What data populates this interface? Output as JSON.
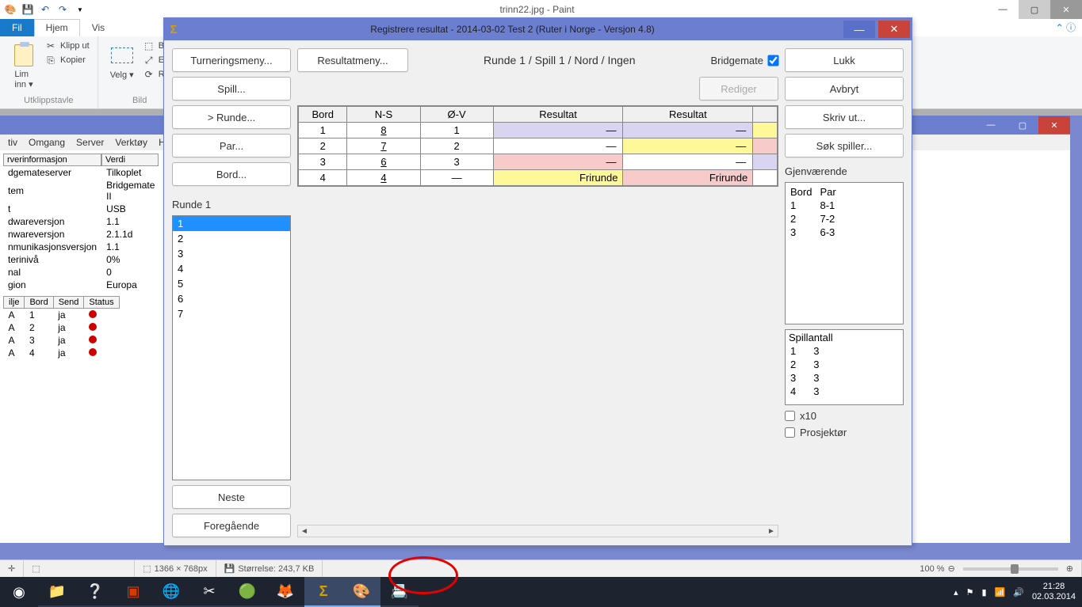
{
  "paint": {
    "title": "trinn22.jpg - Paint",
    "tabs": {
      "fil": "Fil",
      "hjem": "Hjem",
      "vis": "Vis"
    },
    "clipboard": {
      "paste": "Lim\ninn",
      "cut": "Klipp ut",
      "copy": "Kopier",
      "group": "Utklippstavle"
    },
    "image": {
      "select": "Velg",
      "crop": "Bes",
      "resize": "En",
      "rotate": "Rot",
      "group": "Bild"
    },
    "status": {
      "dims": "1366 × 768px",
      "size": "Størrelse: 243,7 KB",
      "zoom": "100 %"
    }
  },
  "bg": {
    "menu": [
      "tiv",
      "Omgang",
      "Server",
      "Verktøy",
      "Hj"
    ],
    "infoHead": [
      "rverinformasjon",
      "Verdi"
    ],
    "info": [
      [
        "dgemateserver",
        "Tilkoplet"
      ],
      [
        "tem",
        "Bridgemate II"
      ],
      [
        "t",
        "USB"
      ],
      [
        "dwareversjon",
        "1.1"
      ],
      [
        "nwareversjon",
        "2.1.1d"
      ],
      [
        "nmunikasjonsversjon",
        "1.1"
      ],
      [
        "terinivå",
        "0%"
      ],
      [
        "nal",
        "0"
      ],
      [
        "gion",
        "Europa"
      ]
    ],
    "tblHead": [
      "ilje",
      "Bord",
      "Send",
      "Status"
    ],
    "rows": [
      [
        "A",
        "1",
        "ja"
      ],
      [
        "A",
        "2",
        "ja"
      ],
      [
        "A",
        "3",
        "ja"
      ],
      [
        "A",
        "4",
        "ja"
      ]
    ]
  },
  "dlg": {
    "title": "Registrere resultat - 2014-03-02  Test 2  (Ruter i Norge - Versjon 4.8)",
    "left": {
      "turn": "Turneringsmeny...",
      "spill": "Spill...",
      "runde": ">   Runde...",
      "par": "Par...",
      "bord": "Bord...",
      "rundeLabel": "Runde 1",
      "rounds": [
        "1",
        "2",
        "3",
        "4",
        "5",
        "6",
        "7"
      ],
      "neste": "Neste",
      "fore": "Foregående"
    },
    "mid": {
      "resmenu": "Resultatmeny...",
      "info": "Runde 1 / Spill 1 / Nord / Ingen",
      "bm": "Bridgemate",
      "rediger": "Rediger",
      "head": [
        "Bord",
        "N-S",
        "Ø-V",
        "Resultat",
        "Resultat"
      ],
      "rows": [
        {
          "bord": "1",
          "ns": "8",
          "ov": "1",
          "r1": "—",
          "r1c": "res-lav",
          "r2": "—",
          "r2c": "res-lav",
          "r3c": "res-yel"
        },
        {
          "bord": "2",
          "ns": "7",
          "ov": "2",
          "r1": "—",
          "r1c": "res-wht",
          "r2": "—",
          "r2c": "res-yel",
          "r3c": "res-pnk"
        },
        {
          "bord": "3",
          "ns": "6",
          "ov": "3",
          "r1": "—",
          "r1c": "res-pnk",
          "r2": "—",
          "r2c": "res-wht",
          "r3c": "res-lav"
        },
        {
          "bord": "4",
          "ns": "4",
          "ov": "—",
          "r1": "Frirunde",
          "r1c": "res-yel",
          "r2": "Frirunde",
          "r2c": "res-pnk",
          "r3c": ""
        }
      ]
    },
    "right": {
      "lukk": "Lukk",
      "avbryt": "Avbryt",
      "skriv": "Skriv ut...",
      "sok": "Søk spiller...",
      "gjLabel": "Gjenværende",
      "gjHead": [
        "Bord",
        "Par"
      ],
      "gj": [
        [
          "1",
          "8-1"
        ],
        [
          "2",
          "7-2"
        ],
        [
          "3",
          "6-3"
        ]
      ],
      "spLabel": "Spillantall",
      "sp": [
        [
          "1",
          "3"
        ],
        [
          "2",
          "3"
        ],
        [
          "3",
          "3"
        ],
        [
          "4",
          "3"
        ]
      ],
      "x10": "x10",
      "proj": "Prosjektør"
    }
  },
  "taskbar": {
    "clock": "21:28",
    "date": "02.03.2014"
  }
}
